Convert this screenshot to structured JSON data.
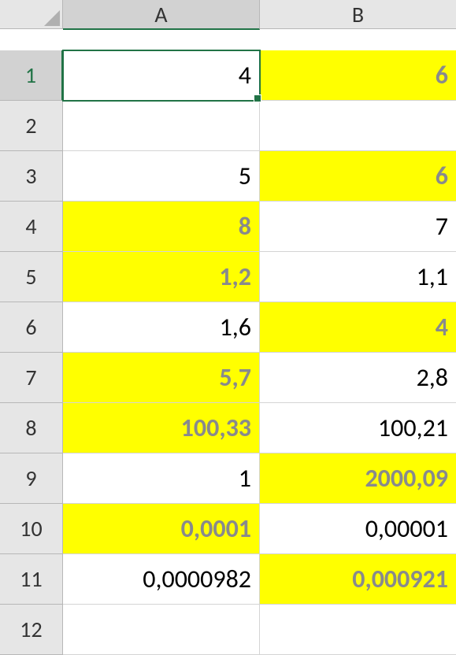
{
  "chart_data": {
    "type": "table",
    "columns": [
      "A",
      "B"
    ],
    "rows": [
      {
        "row": 1,
        "A": "4",
        "B": "6"
      },
      {
        "row": 2,
        "A": "",
        "B": ""
      },
      {
        "row": 3,
        "A": "5",
        "B": "6"
      },
      {
        "row": 4,
        "A": "8",
        "B": "7"
      },
      {
        "row": 5,
        "A": "1,2",
        "B": "1,1"
      },
      {
        "row": 6,
        "A": "1,6",
        "B": "4"
      },
      {
        "row": 7,
        "A": "5,7",
        "B": "2,8"
      },
      {
        "row": 8,
        "A": "100,33",
        "B": "100,21"
      },
      {
        "row": 9,
        "A": "1",
        "B": "2000,09"
      },
      {
        "row": 10,
        "A": "0,0001",
        "B": "0,00001"
      },
      {
        "row": 11,
        "A": "0,0000982",
        "B": "0,000921"
      },
      {
        "row": 12,
        "A": "",
        "B": ""
      }
    ],
    "highlighted_cells": [
      "B1",
      "B3",
      "A4",
      "A5",
      "B6",
      "A7",
      "A8",
      "B9",
      "A10",
      "B11"
    ],
    "active_cell": "A1"
  },
  "columns": {
    "A": "A",
    "B": "B"
  },
  "rows": {
    "1": "1",
    "2": "2",
    "3": "3",
    "4": "4",
    "5": "5",
    "6": "6",
    "7": "7",
    "8": "8",
    "9": "9",
    "10": "10",
    "11": "11",
    "12": "12"
  },
  "cells": {
    "A1": "4",
    "B1": "6",
    "A2": "",
    "B2": "",
    "A3": "5",
    "B3": "6",
    "A4": "8",
    "B4": "7",
    "A5": "1,2",
    "B5": "1,1",
    "A6": "1,6",
    "B6": "4",
    "A7": "5,7",
    "B7": "2,8",
    "A8": "100,33",
    "B8": "100,21",
    "A9": "1",
    "B9": "2000,09",
    "A10": "0,0001",
    "B10": "0,00001",
    "A11": "0,0000982",
    "B11": "0,000921",
    "A12": "",
    "B12": ""
  }
}
